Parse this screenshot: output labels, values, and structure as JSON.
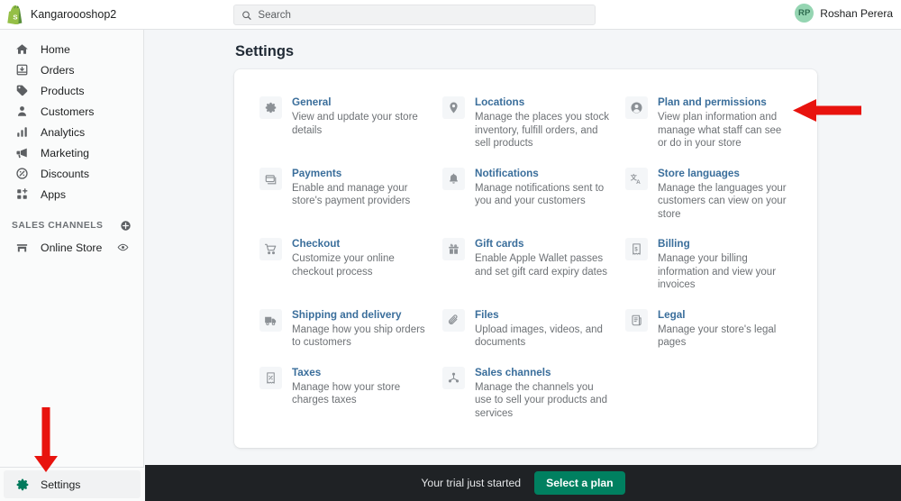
{
  "topbar": {
    "logo_icon": "shopify-logo-icon",
    "store_name": "Kangaroooshop2",
    "search": {
      "icon": "search-icon",
      "placeholder": "Search",
      "value": ""
    },
    "user": {
      "initials": "RP",
      "name": "Roshan Perera"
    }
  },
  "sidebar": {
    "items": [
      {
        "label": "Home",
        "icon": "home-icon"
      },
      {
        "label": "Orders",
        "icon": "orders-inbox-icon"
      },
      {
        "label": "Products",
        "icon": "products-tag-icon"
      },
      {
        "label": "Customers",
        "icon": "customers-person-icon"
      },
      {
        "label": "Analytics",
        "icon": "analytics-bars-icon"
      },
      {
        "label": "Marketing",
        "icon": "marketing-megaphone-icon"
      },
      {
        "label": "Discounts",
        "icon": "discounts-percent-icon"
      },
      {
        "label": "Apps",
        "icon": "apps-grid-icon"
      }
    ],
    "sales_channels": {
      "title": "SALES CHANNELS",
      "add_icon": "plus-circle-icon",
      "channels": [
        {
          "label": "Online Store",
          "icon": "storefront-icon",
          "action_icon": "eye-icon"
        }
      ]
    },
    "settings": {
      "label": "Settings",
      "icon": "gear-icon",
      "active": true
    }
  },
  "main": {
    "page_title": "Settings",
    "settings_items": [
      {
        "title": "General",
        "desc": "View and update your store details",
        "icon": "gear-icon"
      },
      {
        "title": "Locations",
        "desc": "Manage the places you stock inventory, fulfill orders, and sell products",
        "icon": "location-pin-icon"
      },
      {
        "title": "Plan and permissions",
        "desc": "View plan information and manage what staff can see or do in your store",
        "icon": "person-circle-icon"
      },
      {
        "title": "Payments",
        "desc": "Enable and manage your store's payment providers",
        "icon": "payment-card-icon"
      },
      {
        "title": "Notifications",
        "desc": "Manage notifications sent to you and your customers",
        "icon": "bell-icon"
      },
      {
        "title": "Store languages",
        "desc": "Manage the languages your customers can view on your store",
        "icon": "translate-icon"
      },
      {
        "title": "Checkout",
        "desc": "Customize your online checkout process",
        "icon": "shopping-cart-icon"
      },
      {
        "title": "Gift cards",
        "desc": "Enable Apple Wallet passes and set gift card expiry dates",
        "icon": "gift-card-icon"
      },
      {
        "title": "Billing",
        "desc": "Manage your billing information and view your invoices",
        "icon": "billing-receipt-icon"
      },
      {
        "title": "Shipping and delivery",
        "desc": "Manage how you ship orders to customers",
        "icon": "shipping-truck-icon"
      },
      {
        "title": "Files",
        "desc": "Upload images, videos, and documents",
        "icon": "paperclip-icon"
      },
      {
        "title": "Legal",
        "desc": "Manage your store's legal pages",
        "icon": "legal-scroll-icon"
      },
      {
        "title": "Taxes",
        "desc": "Manage how your store charges taxes",
        "icon": "taxes-receipt-icon"
      },
      {
        "title": "Sales channels",
        "desc": "Manage the channels you use to sell your products and services",
        "icon": "channels-network-icon"
      }
    ]
  },
  "bottom_banner": {
    "text": "Your trial just started",
    "button_label": "Select a plan"
  },
  "annotations": [
    {
      "name": "arrow-pointing-to-plan-and-permissions",
      "direction": "left",
      "color": "#e8130e"
    },
    {
      "name": "arrow-pointing-to-settings-nav",
      "direction": "down",
      "color": "#e8130e"
    }
  ],
  "colors": {
    "brand_green": "#008060",
    "link_blue": "#3a6e9b",
    "annotation_red": "#e8130e",
    "banner_dark": "#1f2225",
    "page_bg": "#f4f6f8"
  }
}
